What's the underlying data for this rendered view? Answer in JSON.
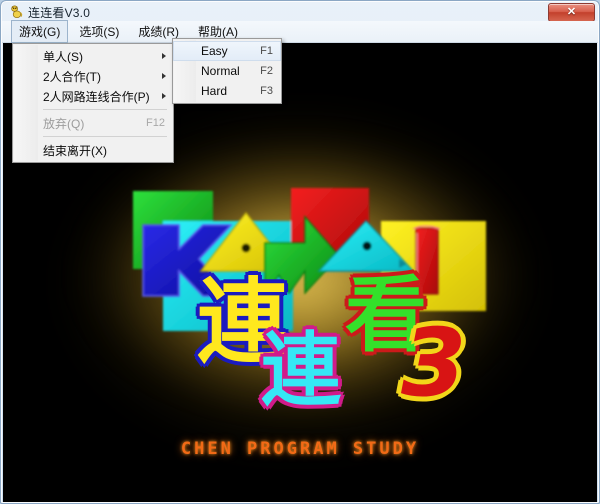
{
  "window": {
    "title": "连连看V3.0",
    "app_icon": "game-mascot-icon",
    "close_label": "✕",
    "frame_color": "#8ba7c4"
  },
  "menubar": {
    "items": [
      {
        "label": "游戏(G)",
        "name": "menu-game",
        "active": true
      },
      {
        "label": "选项(S)",
        "name": "menu-options",
        "active": false
      },
      {
        "label": "成绩(R)",
        "name": "menu-scores",
        "active": false
      },
      {
        "label": "帮助(A)",
        "name": "menu-help",
        "active": false
      }
    ]
  },
  "game_menu": {
    "items": [
      {
        "label": "单人(S)",
        "accel": "",
        "submenu": true,
        "disabled": false
      },
      {
        "label": "2人合作(T)",
        "accel": "",
        "submenu": true,
        "disabled": false
      },
      {
        "label": "2人网路连线合作(P)",
        "accel": "",
        "submenu": true,
        "disabled": false
      },
      {
        "separator": true
      },
      {
        "label": "放弃(Q)",
        "accel": "F12",
        "submenu": false,
        "disabled": true
      },
      {
        "separator": true
      },
      {
        "label": "结束离开(X)",
        "accel": "",
        "submenu": false,
        "disabled": false
      }
    ]
  },
  "level_menu": {
    "items": [
      {
        "label": "Easy",
        "accel": "F1",
        "highlighted": true
      },
      {
        "label": "Normal",
        "accel": "F2",
        "highlighted": false
      },
      {
        "label": "Hard",
        "accel": "F3",
        "highlighted": false
      }
    ]
  },
  "splash": {
    "footer": "CHEN PROGRAM STUDY",
    "footer_color": "#f26a16",
    "background_color": "#000000",
    "glow_color": "#d6b03a",
    "logo_letters": "KAWAI",
    "cjk": [
      {
        "char": "連",
        "fill": "#ffe81e",
        "outline": "#1b1bbf"
      },
      {
        "char": "連",
        "fill": "#35e8f5",
        "outline": "#d01b8a"
      },
      {
        "char": "看",
        "fill": "#34e02a",
        "outline": "#cc1a1a"
      },
      {
        "char": "3",
        "fill": "#d81414",
        "outline": "#f2d61a"
      }
    ],
    "tiles": [
      {
        "shape": "square",
        "color": "#1bb524"
      },
      {
        "shape": "square",
        "color": "#14d9e0"
      },
      {
        "shape": "square",
        "color": "#e01010"
      },
      {
        "shape": "square",
        "color": "#f2e211"
      },
      {
        "shape": "letter-k",
        "color": "#1a1acc"
      },
      {
        "shape": "triangle",
        "color": "#f2e211"
      },
      {
        "shape": "arrow-w",
        "color": "#12c921"
      },
      {
        "shape": "triangle",
        "color": "#2ad2e8"
      },
      {
        "shape": "bar-i",
        "color": "#e01414"
      }
    ]
  }
}
